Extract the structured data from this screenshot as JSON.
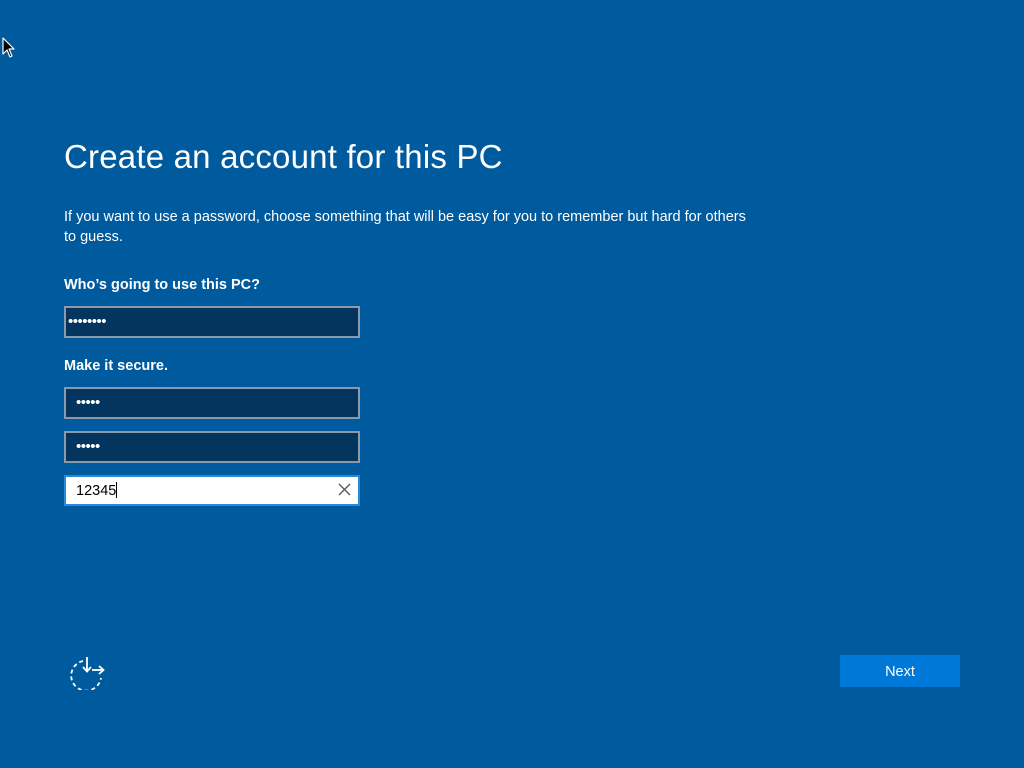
{
  "colors": {
    "background": "#005a9e",
    "field_background": "#03355f",
    "field_border": "#8a9aab",
    "active_field_border": "#2b88d8",
    "button": "#0078d7",
    "text": "#ffffff"
  },
  "page": {
    "title": "Create an account for this PC",
    "description": "If you want to use a password, choose something that will be easy for you to remember but hard for others to guess."
  },
  "form": {
    "user_label": "Who’s going to use this PC?",
    "username_value": "••••••••",
    "secure_label": "Make it secure.",
    "password_value": "•••••",
    "password_confirm_value": "•••••",
    "hint_value": "12345"
  },
  "icons": {
    "cursor": "mouse-pointer-icon",
    "clear": "close-icon",
    "ease_of_access": "ease-of-access-icon"
  },
  "buttons": {
    "next_label": "Next"
  }
}
